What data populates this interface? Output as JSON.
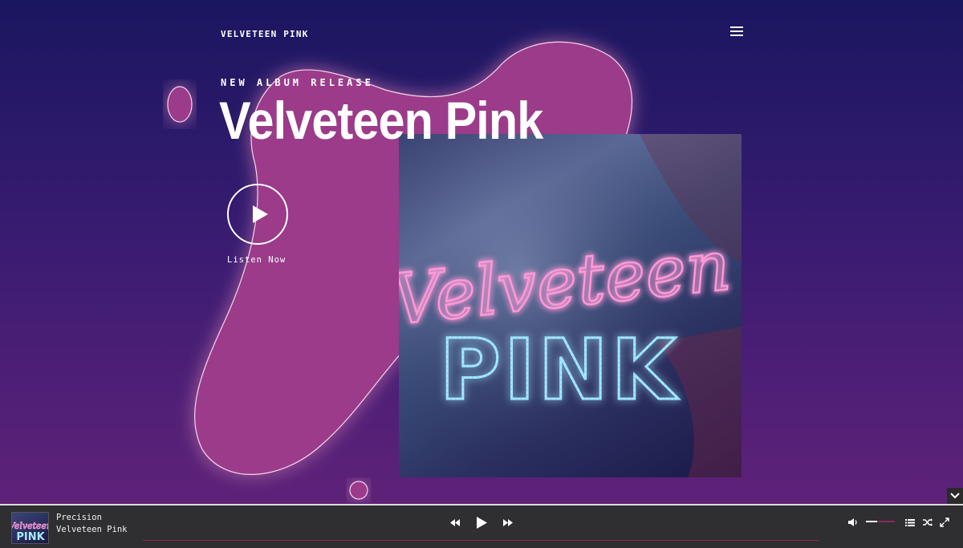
{
  "site": {
    "brand": "VELVETEEN PINK",
    "menu_icon": "hamburger-icon"
  },
  "hero": {
    "eyebrow": "NEW ALBUM RELEASE",
    "title": "Velveteen Pink",
    "listen_label": "Listen Now",
    "blob_color": "#9b3b8a",
    "album_art": {
      "script_text": "Velveteen",
      "block_text": "PINK",
      "script_color": "#ff7ad0",
      "block_color": "#8fe0ff"
    }
  },
  "scroll_down_icon": "chevron-down-icon",
  "player": {
    "track_title": "Precision",
    "track_artist": "Velveteen Pink",
    "thumbnail": {
      "script_text": "Velveteen",
      "block_text": "PINK"
    },
    "controls": [
      "previous-icon",
      "play-icon",
      "next-icon"
    ],
    "right_icons": [
      "volume-icon",
      "playlist-icon",
      "shuffle-icon",
      "fullscreen-icon"
    ],
    "volume_level": 0.4,
    "progress": 0,
    "accent_color": "#8a2a5a"
  }
}
